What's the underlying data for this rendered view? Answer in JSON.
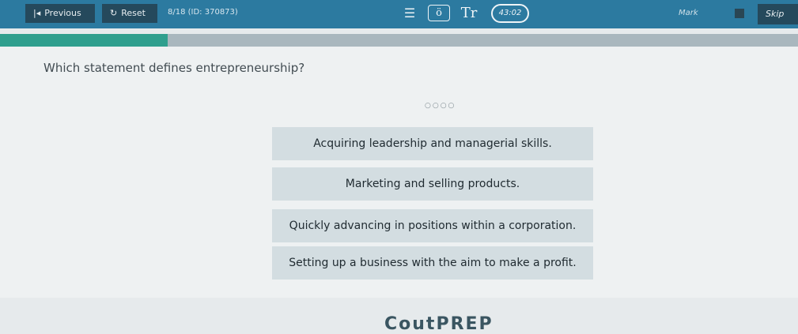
{
  "toolbar": {
    "previous_label": "Previous",
    "previous_icon": "previous-icon",
    "reset_label": "Reset",
    "reset_icon": "reset-icon",
    "question_position": "8/18 (ID: 370873)",
    "list_icon": "list-icon",
    "zoom_icon_glyph": "ö",
    "text_icon_glyph": "Tr",
    "timer": "43:02",
    "mark_label": "Mark",
    "skip_label": "Skip"
  },
  "progress": {
    "fraction": 0.21,
    "fill_color": "#2f9f8e"
  },
  "question": {
    "text": "Which statement defines entrepreneurship?",
    "dots": "○○○○",
    "options": [
      {
        "label": "Acquiring leadership and managerial skills."
      },
      {
        "label": "Marketing and selling products."
      },
      {
        "label": "Quickly advancing in positions within a corporation."
      },
      {
        "label": "Setting up a business with the aim to make a profit."
      }
    ]
  },
  "footer": {
    "logo_partial": "CoutPREP"
  },
  "colors": {
    "toolbar": "#2c7aa0",
    "button": "#25495c",
    "option_bg": "#d3dde1"
  }
}
